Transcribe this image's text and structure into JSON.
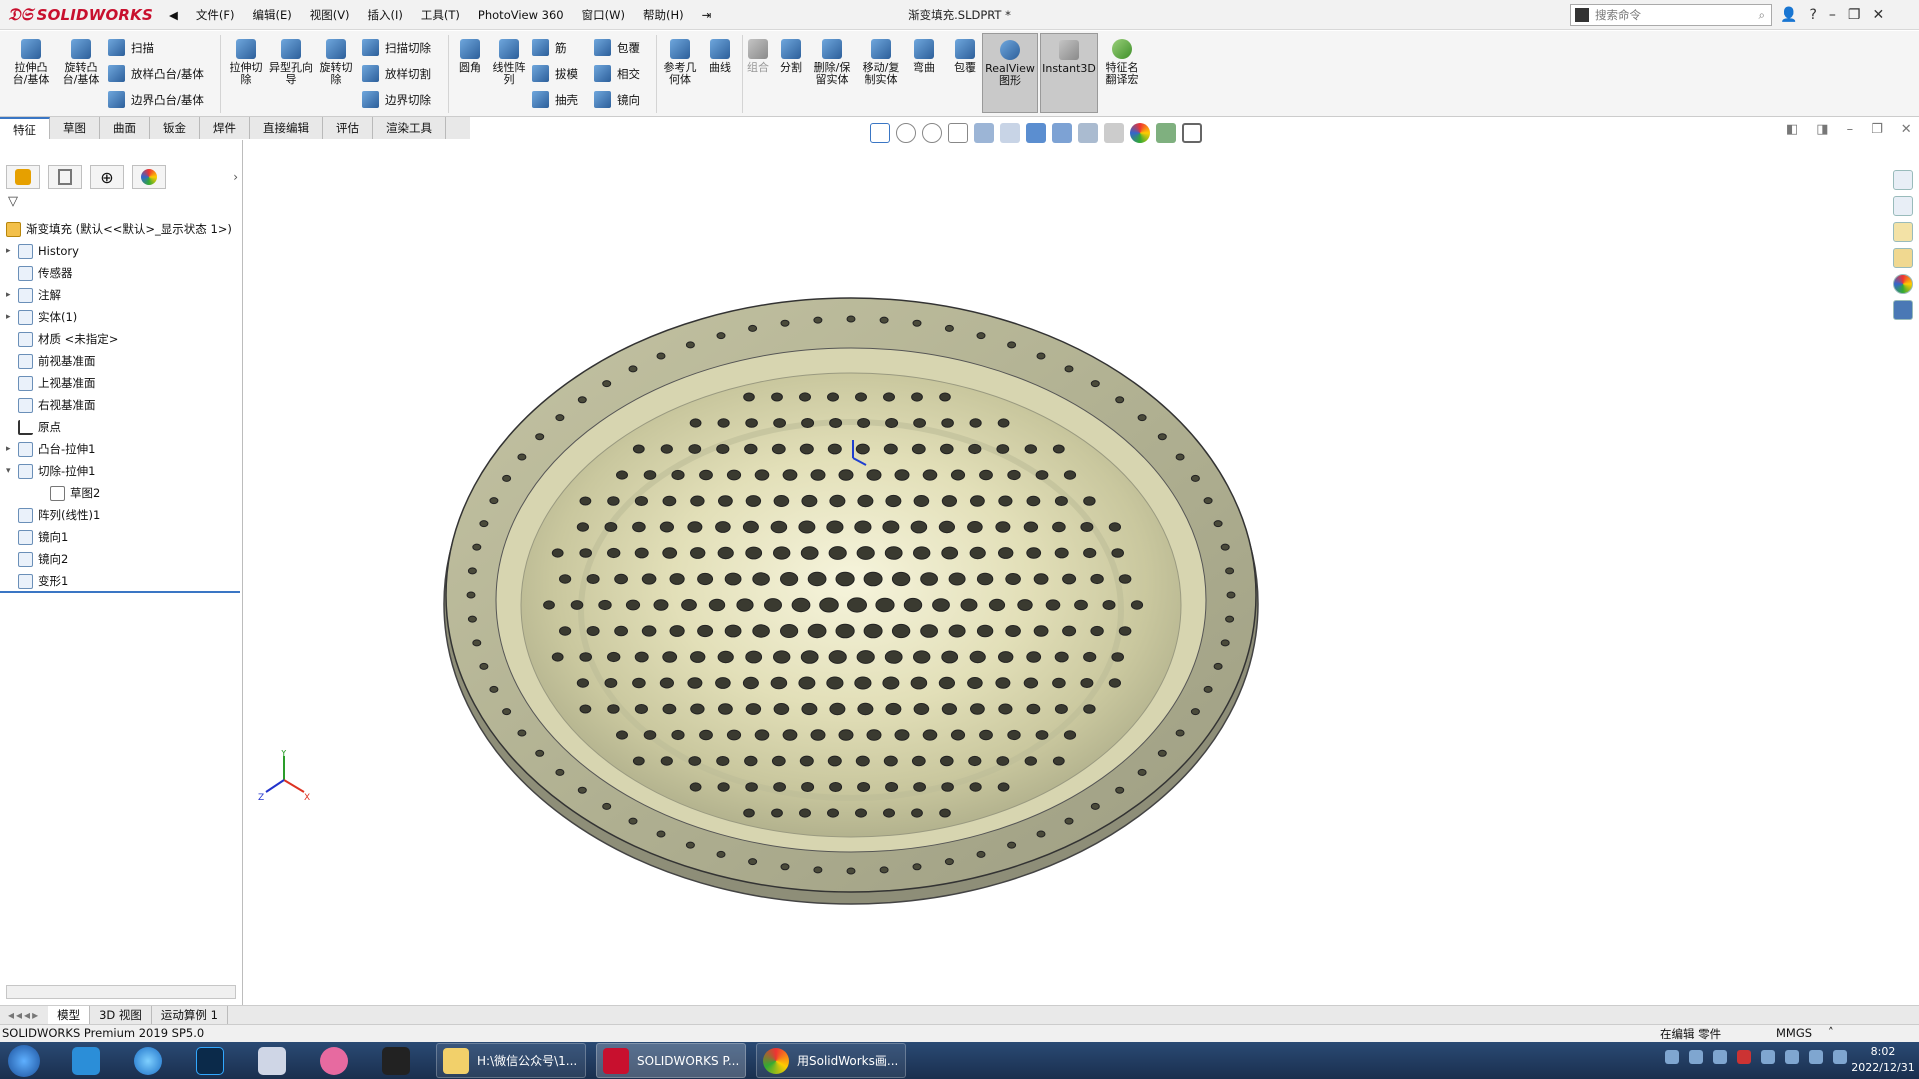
{
  "app": {
    "brand": "SOLIDWORKS",
    "document_title": "渐变填充.SLDPRT *",
    "menu": [
      "文件(F)",
      "编辑(E)",
      "视图(V)",
      "插入(I)",
      "工具(T)",
      "PhotoView 360",
      "窗口(W)",
      "帮助(H)"
    ],
    "search_placeholder": "搜索命令"
  },
  "ribbon": {
    "large_buttons": [
      {
        "id": "extrude-boss",
        "label": "拉伸凸台/基体"
      },
      {
        "id": "revolve-boss",
        "label": "旋转凸台/基体"
      },
      {
        "id": "extrude-cut",
        "label": "拉伸切除"
      },
      {
        "id": "hole-wizard",
        "label": "异型孔向导"
      },
      {
        "id": "revolve-cut",
        "label": "旋转切除"
      },
      {
        "id": "fillet",
        "label": "圆角"
      },
      {
        "id": "linear-pattern",
        "label": "线性阵列"
      },
      {
        "id": "ref-geometry",
        "label": "参考几何体"
      },
      {
        "id": "curves",
        "label": "曲线"
      },
      {
        "id": "combine",
        "label": "组合"
      },
      {
        "id": "split",
        "label": "分割"
      },
      {
        "id": "delete-keep-body",
        "label": "删除/保留实体"
      },
      {
        "id": "move-copy-body",
        "label": "移动/复制实体"
      },
      {
        "id": "flex",
        "label": "弯曲"
      },
      {
        "id": "wrap2",
        "label": "包覆"
      },
      {
        "id": "realview",
        "label": "RealView图形"
      },
      {
        "id": "instant3d",
        "label": "Instant3D"
      },
      {
        "id": "feature-translate",
        "label": "特征名翻译宏"
      }
    ],
    "small_buttons": [
      {
        "id": "sweep",
        "label": "扫描"
      },
      {
        "id": "loft-boss",
        "label": "放样凸台/基体"
      },
      {
        "id": "boundary-boss",
        "label": "边界凸台/基体"
      },
      {
        "id": "swept-cut",
        "label": "扫描切除"
      },
      {
        "id": "lofted-cut",
        "label": "放样切割"
      },
      {
        "id": "boundary-cut",
        "label": "边界切除"
      },
      {
        "id": "rib",
        "label": "筋"
      },
      {
        "id": "draft",
        "label": "拔模"
      },
      {
        "id": "shell",
        "label": "抽壳"
      },
      {
        "id": "wrap",
        "label": "包覆"
      },
      {
        "id": "intersect",
        "label": "相交"
      },
      {
        "id": "mirror",
        "label": "镜向"
      }
    ],
    "tabs": [
      "特征",
      "草图",
      "曲面",
      "钣金",
      "焊件",
      "直接编辑",
      "评估",
      "渲染工具"
    ],
    "active_tab": "特征"
  },
  "feature_tree": {
    "root": "渐变填充 (默认<<默认>_显示状态 1>)",
    "items": [
      {
        "label": "History",
        "expandable": true
      },
      {
        "label": "传感器",
        "expandable": false
      },
      {
        "label": "注解",
        "expandable": true
      },
      {
        "label": "实体(1)",
        "expandable": true
      },
      {
        "label": "材质 <未指定>",
        "expandable": false
      },
      {
        "label": "前视基准面",
        "expandable": false
      },
      {
        "label": "上视基准面",
        "expandable": false
      },
      {
        "label": "右视基准面",
        "expandable": false
      },
      {
        "label": "原点",
        "expandable": false
      },
      {
        "label": "凸台-拉伸1",
        "expandable": true
      },
      {
        "label": "切除-拉伸1",
        "expandable": true,
        "expanded": true
      },
      {
        "label": "草图2",
        "expandable": false,
        "child": true
      },
      {
        "label": "阵列(线性)1",
        "expandable": false
      },
      {
        "label": "镜向1",
        "expandable": false
      },
      {
        "label": "镜向2",
        "expandable": false
      },
      {
        "label": "变形1",
        "expandable": false
      }
    ]
  },
  "bottom_tabs": [
    "模型",
    "3D 视图",
    "运动算例 1"
  ],
  "status": {
    "left": "SOLIDWORKS Premium 2019 SP5.0",
    "editing": "在编辑 零件",
    "units": "MMGS"
  },
  "taskbar": {
    "windows": [
      {
        "label": "H:\\微信公众号\\1..."
      },
      {
        "label": "SOLIDWORKS P..."
      },
      {
        "label": "用SolidWorks画..."
      }
    ],
    "time": "8:02",
    "date": "2022/12/31"
  },
  "colors": {
    "brand_red": "#c8102e",
    "part_metal": "#b9bd9a",
    "accent_blue": "#3a76c4"
  }
}
